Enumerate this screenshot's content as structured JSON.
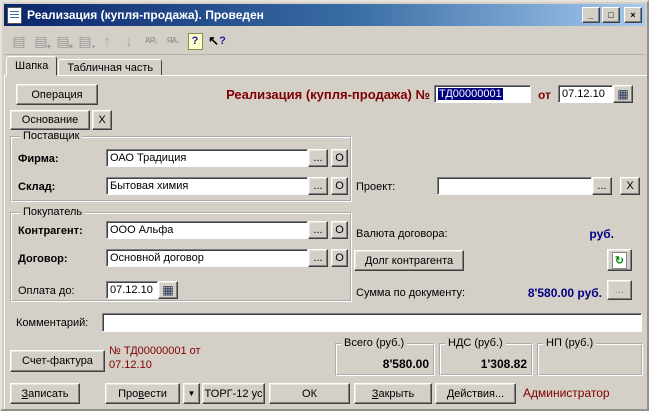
{
  "window": {
    "title": "Реализация (купля-продажа). Проведен",
    "controls": {
      "minimize": "_",
      "maximize": "□",
      "close": "×"
    }
  },
  "toolbar": {
    "icons": [
      {
        "name": "edit-row-icon",
        "glyph": "▤",
        "badge": ""
      },
      {
        "name": "new-row-icon",
        "glyph": "▤",
        "badge": "+"
      },
      {
        "name": "delete-row-icon",
        "glyph": "▤",
        "badge": "×"
      },
      {
        "name": "copy-row-icon",
        "glyph": "▤",
        "badge": "▪"
      },
      {
        "name": "move-up-icon",
        "glyph": "↑",
        "badge": ""
      },
      {
        "name": "move-down-icon",
        "glyph": "↓",
        "badge": ""
      },
      {
        "name": "sort-asc-icon",
        "glyph": "АЯ↓",
        "badge": ""
      },
      {
        "name": "sort-desc-icon",
        "glyph": "ЯА↓",
        "badge": ""
      },
      {
        "name": "help-icon",
        "glyph": "?",
        "badge": ""
      },
      {
        "name": "context-help-icon",
        "glyph": "↖",
        "badge": "?"
      }
    ]
  },
  "tabs": {
    "header": "Шапка",
    "table_part": "Табличная часть"
  },
  "ui": {
    "ellipsis": "...",
    "open_button": "О",
    "clear_button": "X",
    "calendar_glyph": "▦",
    "refresh_glyph": "↻",
    "dropdown_glyph": "▼"
  },
  "header": {
    "operation_button": "Операция",
    "basis_button": "Основание",
    "doc_title": "Реализация (купля-продажа) №",
    "doc_number": "ТД00000001",
    "ot_label": "от",
    "doc_date": "07.12.10"
  },
  "supplier": {
    "group_label": "Поставщик",
    "firm_label": "Фирма:",
    "firm_value": "ОАО Традиция",
    "warehouse_label": "Склад:",
    "warehouse_value": "Бытовая химия"
  },
  "project": {
    "label": "Проект:",
    "value": ""
  },
  "buyer": {
    "group_label": "Покупатель",
    "contractor_label": "Контрагент:",
    "contractor_value": "ООО Альфа",
    "contract_label": "Договор:",
    "contract_value": "Основной договор",
    "payment_due_label": "Оплата до:",
    "payment_due_value": "07.12.10"
  },
  "contract_info": {
    "currency_label": "Валюта договора:",
    "currency_value": "руб.",
    "debt_button": "Долг контрагента",
    "sum_label": "Сумма по документу:",
    "sum_value": "8'580.00 руб."
  },
  "comment": {
    "label": "Комментарий:",
    "value": ""
  },
  "invoice": {
    "button": "Счет-фактура",
    "info_line1": "№ ТД00000001 от",
    "info_line2": "07.12.10"
  },
  "totals": {
    "total": {
      "label": "Всего (руб.)",
      "value": "8'580.00"
    },
    "vat": {
      "label": "НДС (руб.)",
      "value": "1'308.82"
    },
    "np": {
      "label": "НП (руб.)",
      "value": ""
    }
  },
  "footer": {
    "save": {
      "pre": "",
      "key": "З",
      "post": "аписать"
    },
    "post": {
      "pre": "Про",
      "key": "в",
      "post": "ести"
    },
    "torg_button": "ТОРГ-12 ус",
    "ok_button": "ОК",
    "close": {
      "pre": "",
      "key": "З",
      "post": "акрыть"
    },
    "actions": {
      "pre": "",
      "key": "Д",
      "post": "ействия..."
    },
    "user": "Администратор"
  },
  "colors": {
    "titlebar_left": "#0a246a",
    "titlebar_right": "#a6caf0",
    "accent_red": "#800000",
    "value_blue": "#000080",
    "window_bg": "#d4d0c8",
    "selection_bg": "#000080"
  }
}
